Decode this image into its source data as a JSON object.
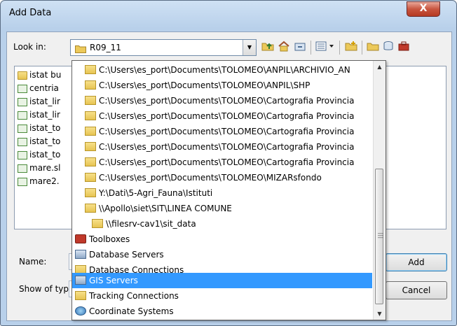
{
  "window": {
    "title": "Add Data",
    "close_glyph": "X"
  },
  "look_in": {
    "label": "Look in:",
    "value": "R09_11"
  },
  "toolbar": {
    "icons": [
      "up-one-level-icon",
      "home-icon",
      "connect-folder-icon",
      "view-menu-icon",
      "new-folder-icon",
      "folder-icon",
      "catalog-icon",
      "toolbox-icon"
    ]
  },
  "files": [
    {
      "name": "istat bu",
      "type": "folder"
    },
    {
      "name": "centria",
      "type": "shapefile"
    },
    {
      "name": "istat_lir",
      "type": "shapefile"
    },
    {
      "name": "istat_lir",
      "type": "shapefile"
    },
    {
      "name": "istat_to",
      "type": "shapefile"
    },
    {
      "name": "istat_to",
      "type": "shapefile"
    },
    {
      "name": "istat_to",
      "type": "shapefile"
    },
    {
      "name": "mare.sl",
      "type": "shapefile"
    },
    {
      "name": "mare2.",
      "type": "shapefile"
    }
  ],
  "name_field": {
    "label": "Name:",
    "value": ""
  },
  "show_type": {
    "label": "Show of typ",
    "value": ""
  },
  "buttons": {
    "add": "Add",
    "cancel": "Cancel"
  },
  "dropdown_items": [
    {
      "text": "C:\\Users\\es_port\\Documents\\TOLOMEO\\ANPIL\\ARCHIVIO_AN",
      "icon": "folder-connection-icon",
      "indent": 2,
      "selected": false
    },
    {
      "text": "C:\\Users\\es_port\\Documents\\TOLOMEO\\ANPIL\\SHP",
      "icon": "folder-connection-icon",
      "indent": 2,
      "selected": false
    },
    {
      "text": "C:\\Users\\es_port\\Documents\\TOLOMEO\\Cartografia Provincia",
      "icon": "folder-connection-icon",
      "indent": 2,
      "selected": false
    },
    {
      "text": "C:\\Users\\es_port\\Documents\\TOLOMEO\\Cartografia Provincia",
      "icon": "folder-connection-icon",
      "indent": 2,
      "selected": false
    },
    {
      "text": "C:\\Users\\es_port\\Documents\\TOLOMEO\\Cartografia Provincia",
      "icon": "folder-connection-icon",
      "indent": 2,
      "selected": false
    },
    {
      "text": "C:\\Users\\es_port\\Documents\\TOLOMEO\\Cartografia Provincia",
      "icon": "folder-connection-icon",
      "indent": 2,
      "selected": false
    },
    {
      "text": "C:\\Users\\es_port\\Documents\\TOLOMEO\\Cartografia Provincia",
      "icon": "folder-connection-icon",
      "indent": 2,
      "selected": false
    },
    {
      "text": "C:\\Users\\es_port\\Documents\\TOLOMEO\\MIZARsfondo",
      "icon": "folder-connection-icon",
      "indent": 2,
      "selected": false
    },
    {
      "text": "Y:\\Dati\\5-Agri_Fauna\\Istituti",
      "icon": "folder-connection-icon",
      "indent": 2,
      "selected": false
    },
    {
      "text": "\\\\Apollo\\siet\\SIT\\LINEA COMUNE",
      "icon": "folder-connection-icon",
      "indent": 2,
      "selected": false
    },
    {
      "text": "\\\\filesrv-cav1\\sit_data",
      "icon": "folder-connection-icon",
      "indent": 2,
      "selected": false
    },
    {
      "text": "Toolboxes",
      "icon": "toolbox-icon",
      "indent": 1,
      "selected": false
    },
    {
      "text": "Database Servers",
      "icon": "database-server-icon",
      "indent": 1,
      "selected": false
    },
    {
      "text": "Database Connections",
      "icon": "database-connection-icon",
      "indent": 1,
      "selected": false
    },
    {
      "text": "GIS Servers",
      "icon": "gis-server-icon",
      "indent": 1,
      "selected": true
    },
    {
      "text": "Tracking Connections",
      "icon": "tracking-connection-icon",
      "indent": 1,
      "selected": false
    },
    {
      "text": "Coordinate Systems",
      "icon": "coordinate-system-icon",
      "indent": 1,
      "selected": false
    }
  ],
  "colors": {
    "selection": "#3399ff",
    "titlebar": "#b8d0ea",
    "close": "#c8553f"
  }
}
